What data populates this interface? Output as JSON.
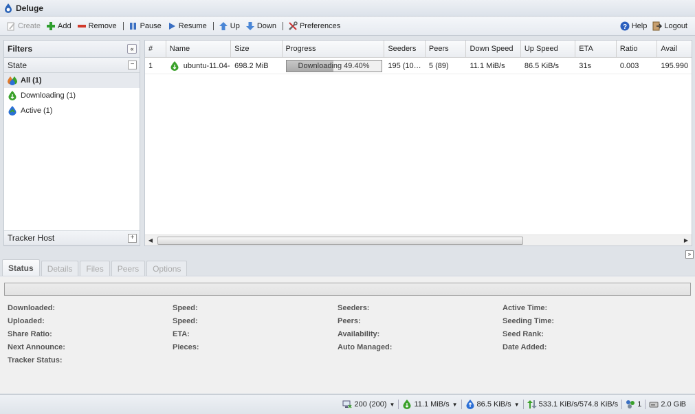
{
  "app": {
    "title": "Deluge"
  },
  "toolbar": {
    "create": "Create",
    "add": "Add",
    "remove": "Remove",
    "pause": "Pause",
    "resume": "Resume",
    "up": "Up",
    "down": "Down",
    "preferences": "Preferences",
    "help": "Help",
    "logout": "Logout"
  },
  "filters": {
    "title": "Filters",
    "state_header": "State",
    "items": [
      {
        "label": "All (1)",
        "selected": true
      },
      {
        "label": "Downloading (1)"
      },
      {
        "label": "Active (1)"
      }
    ],
    "tracker_header": "Tracker Host"
  },
  "torrents": {
    "columns": [
      "#",
      "Name",
      "Size",
      "Progress",
      "Seeders",
      "Peers",
      "Down Speed",
      "Up Speed",
      "ETA",
      "Ratio",
      "Avail"
    ],
    "rows": [
      {
        "num": "1",
        "name": "ubuntu-11.04-",
        "size": "698.2 MiB",
        "progress_label": "Downloading 49.40%",
        "progress": 49.4,
        "seeders": "195 (10…",
        "peers": "5 (89)",
        "down": "11.1 MiB/s",
        "up": "86.5 KiB/s",
        "eta": "31s",
        "ratio": "0.003",
        "avail": "195.990"
      }
    ]
  },
  "details": {
    "tabs": [
      "Status",
      "Details",
      "Files",
      "Peers",
      "Options"
    ],
    "active_tab": "Status",
    "col1": [
      "Downloaded:",
      "Uploaded:",
      "Share Ratio:",
      "Next Announce:",
      "Tracker Status:"
    ],
    "col2": [
      "Speed:",
      "Speed:",
      "ETA:",
      "Pieces:"
    ],
    "col3": [
      "Seeders:",
      "Peers:",
      "Availability:",
      "Auto Managed:"
    ],
    "col4": [
      "Active Time:",
      "Seeding Time:",
      "Seed Rank:",
      "Date Added:"
    ]
  },
  "statusbar": {
    "connections": "200 (200)",
    "down": "11.1 MiB/s",
    "up": "86.5 KiB/s",
    "traffic": "533.1 KiB/s/574.8 KiB/s",
    "dht": "1",
    "free_space": "2.0 GiB"
  },
  "colors": {
    "accent": "#3a72c4",
    "green": "#3aa12a",
    "blue": "#2b6fd6"
  }
}
